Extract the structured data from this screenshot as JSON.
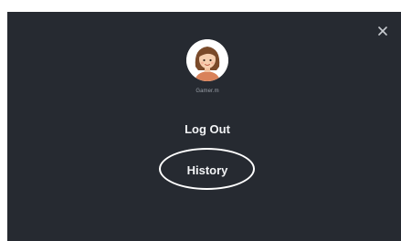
{
  "dialog": {
    "user": {
      "username": "Gamer.m",
      "avatar_icon": "user-avatar-icon"
    },
    "menu": {
      "logout_label": "Log Out",
      "history_label": "History"
    },
    "close_icon": "close-icon",
    "colors": {
      "background": "#262a31",
      "text": "#f2f3f5",
      "muted_text": "#9aa0a8",
      "highlight_ring": "#ffffff"
    }
  }
}
